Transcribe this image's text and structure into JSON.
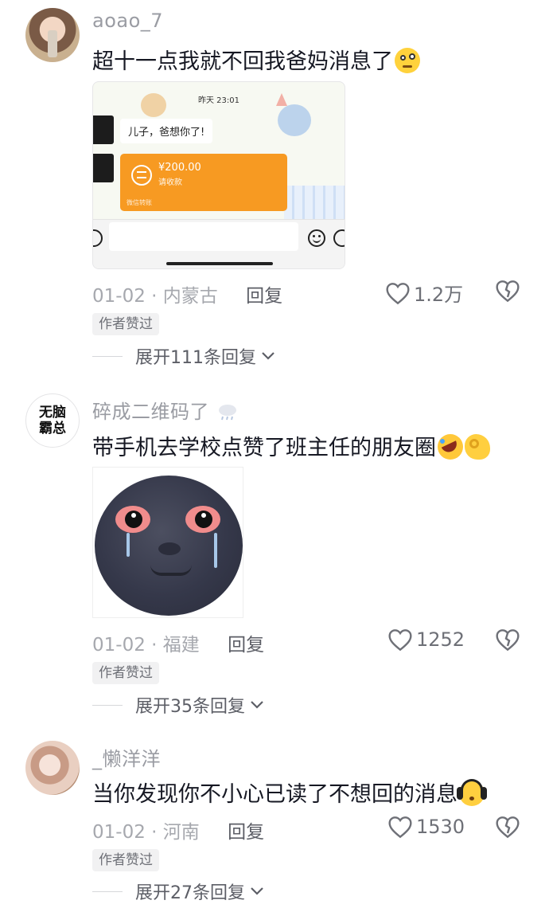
{
  "comments": [
    {
      "username": "aoao_7",
      "text": "超十一点我就不回我爸妈消息了",
      "emoji": "thinking-face-icon",
      "date": "01-02",
      "location": "内蒙古",
      "reply_label": "回复",
      "likes": "1.2万",
      "badge": "作者赞过",
      "expand": "展开111条回复",
      "attachment": {
        "time": "昨天 23:01",
        "message": "儿子，爸想你了!",
        "amount": "¥200.00",
        "pay_sub": "请收款",
        "pay_foot": "微信转账"
      }
    },
    {
      "username": "碎成二维码了",
      "avatar_text": "无脑霸总",
      "text": "带手机去学校点赞了班主任的朋友圈",
      "date": "01-02",
      "location": "福建",
      "reply_label": "回复",
      "likes": "1252",
      "badge": "作者赞过",
      "expand": "展开35条回复"
    },
    {
      "username": "_懒洋洋",
      "text": "当你发现你不小心已读了不想回的消息",
      "date": "01-02",
      "location": "河南",
      "reply_label": "回复",
      "likes": "1530",
      "badge": "作者赞过",
      "expand": "展开27条回复"
    }
  ],
  "separator": "·",
  "colors": {
    "text": "#161823",
    "muted": "#a6a8ae",
    "accent_orange": "#f79a22"
  }
}
